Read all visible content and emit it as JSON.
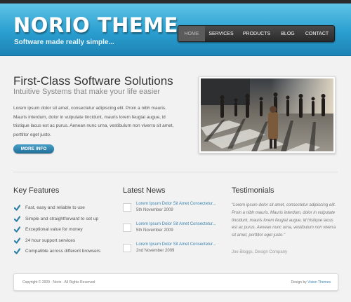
{
  "header": {
    "logo": "NORIO THEME",
    "tagline": "Software made really simple..."
  },
  "nav": {
    "items": [
      "HOME",
      "SERVICES",
      "PRODUCTS",
      "BLOG",
      "CONTACT"
    ]
  },
  "hero": {
    "title": "First-Class Software Solutions",
    "subtitle": "Intuitive Systems that make your life easier",
    "text": "Lorem ipsum dolor sit amet, consectetur adipiscing elit. Proin a nibh mauris. Mauris interdum, dolor in vulputate tincidunt, mauris lorem feugiat augue, id tristique lacus est ac purus. Aenean nunc urna, vestibulum non viverra sit amet, porttitor eget justo.",
    "button": "MORE INFO"
  },
  "features": {
    "title": "Key Features",
    "items": [
      "Fast, easy and reliable to use",
      "Simple and straightforward to set up",
      "Exceptional value for money",
      "24 hour support services",
      "Compatible across different browsers"
    ]
  },
  "news": {
    "title": "Latest News",
    "items": [
      {
        "title": "Lorem Ipsum Dolor Sit Amet Consectetur...",
        "date": "5th November 2009"
      },
      {
        "title": "Lorem Ipsum Dolor Sit Amet Consectetur...",
        "date": "5th November 2009"
      },
      {
        "title": "Lorem Ipsum Dolor Sit Amet Consectetur...",
        "date": "2nd November 2009"
      }
    ]
  },
  "testimonials": {
    "title": "Testimonials",
    "quote": "\"Lorem ipsum dolor sit amet, consectetur adipiscing elit. Proin a nibh mauris. Mauris interdum, dolor in vulputate tincidunt, mauris lorem feugiat augue, id tristique lacus est ac purus. Aenean nunc urna, vestibulum non viverra sit amet, porttitor eget justo.\"",
    "author": "Joe Bloggs, Design Company"
  },
  "footer": {
    "copyright": "Copyright © 2009 · Norio · All Rights Reserved",
    "design_prefix": "Design by",
    "design_link": "Vision Themes"
  },
  "colors": {
    "header_blue": "#2a9fd0",
    "link_blue": "#3a86b4",
    "check_teal": "#2f7fa6"
  }
}
